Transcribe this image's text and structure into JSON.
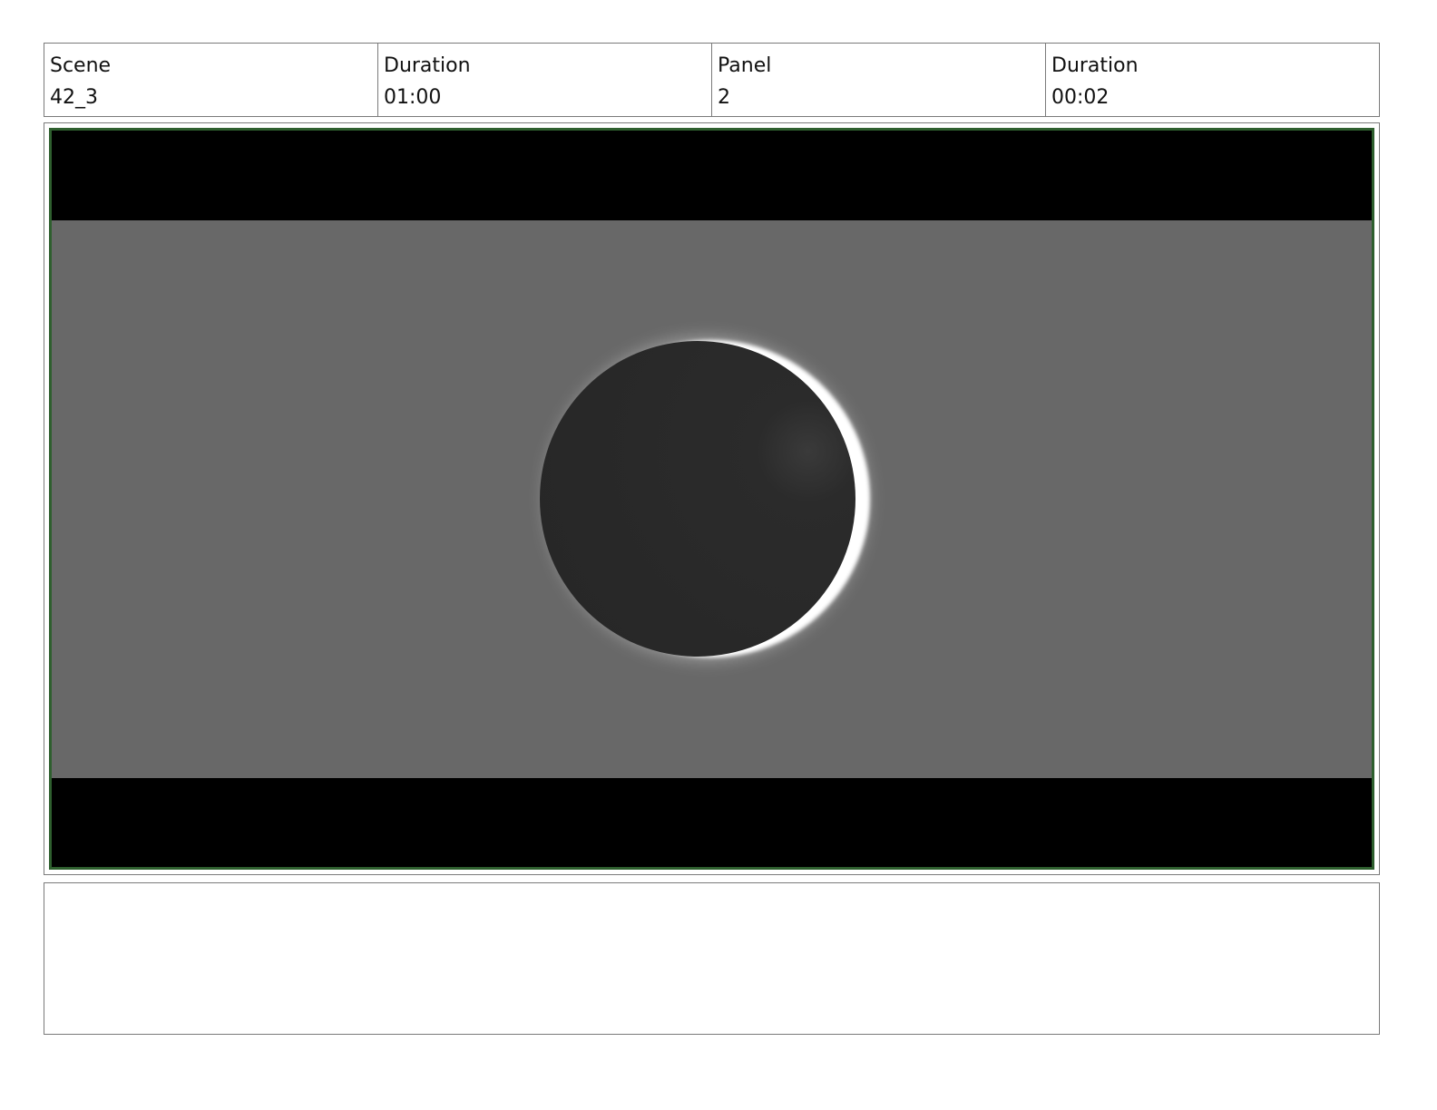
{
  "header": {
    "scene": {
      "label": "Scene",
      "value": "42_3"
    },
    "scene_duration": {
      "label": "Duration",
      "value": "01:00"
    },
    "panel": {
      "label": "Panel",
      "value": "2"
    },
    "panel_duration": {
      "label": "Duration",
      "value": "00:02"
    }
  },
  "panel_image": {
    "letterbox_color": "#000000",
    "sky_color": "#686868",
    "disc_color": "#282828",
    "crescent_color": "#ffffff",
    "frame_border_color": "#2e5f2e"
  },
  "notes": {
    "text": ""
  }
}
